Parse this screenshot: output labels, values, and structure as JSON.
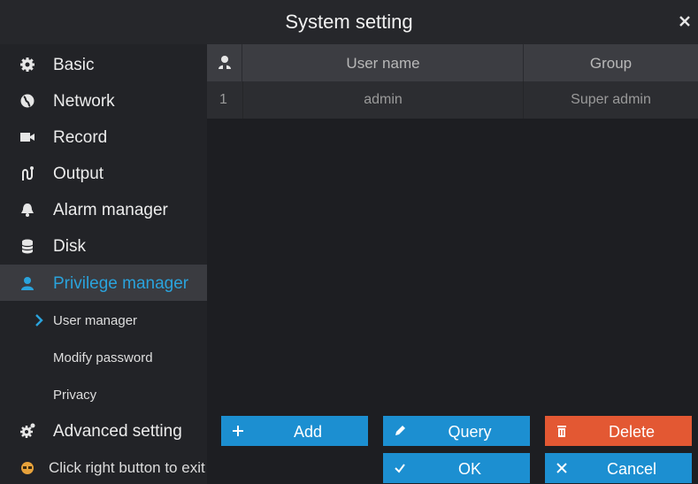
{
  "window": {
    "title": "System setting",
    "close_icon": "close-icon"
  },
  "sidebar": {
    "items": [
      {
        "label": "Basic",
        "icon": "gear-icon"
      },
      {
        "label": "Network",
        "icon": "globe-icon"
      },
      {
        "label": "Record",
        "icon": "video-camera-icon"
      },
      {
        "label": "Output",
        "icon": "output-icon"
      },
      {
        "label": "Alarm manager",
        "icon": "bell-icon"
      },
      {
        "label": "Disk",
        "icon": "database-icon"
      },
      {
        "label": "Privilege manager",
        "icon": "user-icon",
        "active": true
      },
      {
        "label": "Advanced setting",
        "icon": "gears-icon"
      }
    ],
    "sub_items": [
      {
        "label": "User manager",
        "selected": true
      },
      {
        "label": "Modify password"
      },
      {
        "label": "Privacy"
      }
    ]
  },
  "table": {
    "header_icon": "user-icon",
    "columns": [
      "User name",
      "Group"
    ],
    "rows": [
      {
        "index": "1",
        "user_name": "admin",
        "group": "Super admin"
      }
    ]
  },
  "actions": {
    "add": "Add",
    "query": "Query",
    "delete": "Delete",
    "ok": "OK",
    "cancel": "Cancel"
  },
  "footer": {
    "hint": "Click right button to exit",
    "hint_icon": "mouse-icon"
  },
  "colors": {
    "accent": "#2aa3dc",
    "button_blue": "#1c8fd1",
    "button_red": "#e35833",
    "background": "#1d1e22"
  }
}
